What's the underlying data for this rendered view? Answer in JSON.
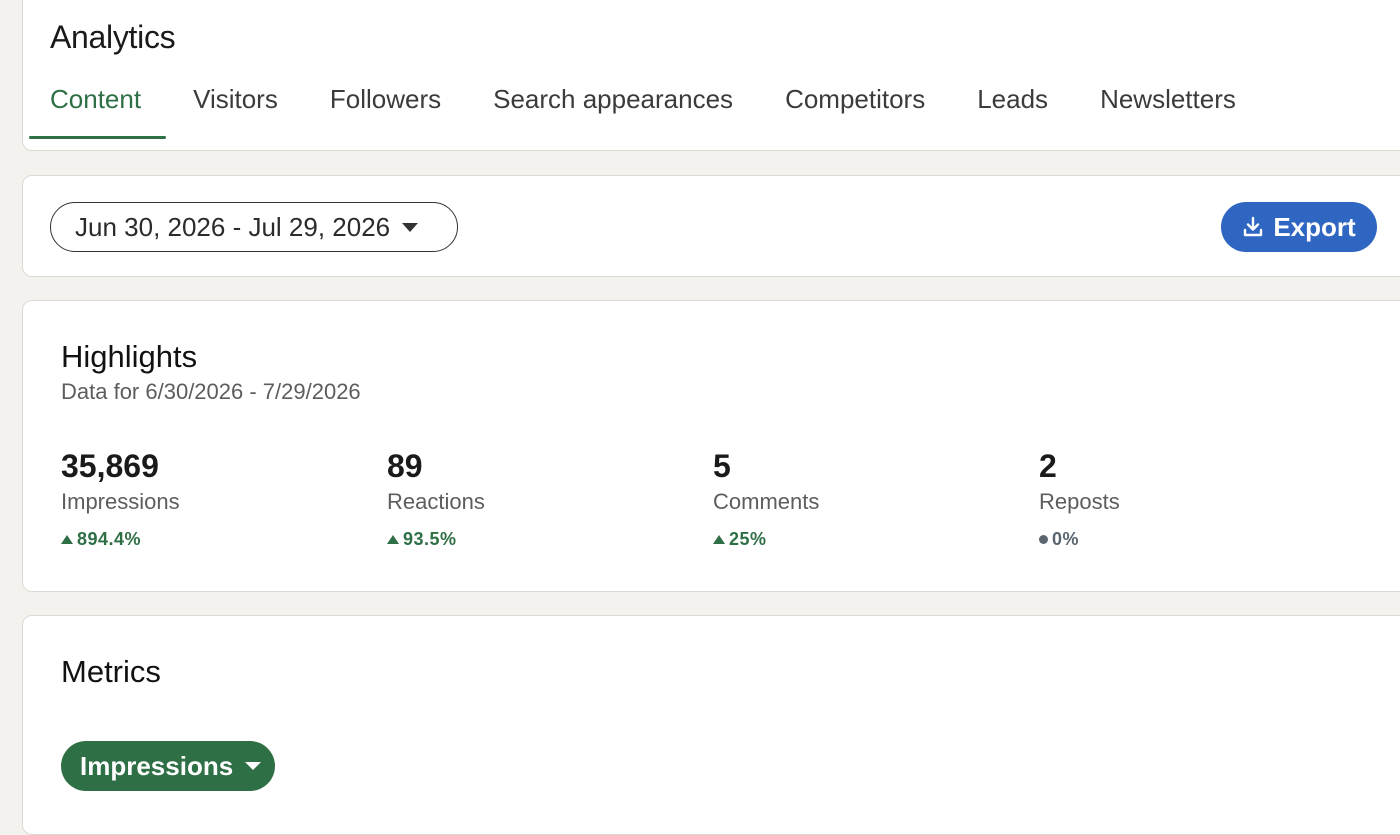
{
  "header": {
    "title": "Analytics",
    "tabs": [
      {
        "label": "Content",
        "active": true
      },
      {
        "label": "Visitors",
        "active": false
      },
      {
        "label": "Followers",
        "active": false
      },
      {
        "label": "Search appearances",
        "active": false
      },
      {
        "label": "Competitors",
        "active": false
      },
      {
        "label": "Leads",
        "active": false
      },
      {
        "label": "Newsletters",
        "active": false
      }
    ]
  },
  "toolbar": {
    "date_range": "Jun 30, 2026 - Jul 29, 2026",
    "export_label": "Export"
  },
  "highlights": {
    "title": "Highlights",
    "subtitle": "Data for 6/30/2026 - 7/29/2026",
    "stats": [
      {
        "value": "35,869",
        "label": "Impressions",
        "change": "894.4%",
        "trend": "up"
      },
      {
        "value": "89",
        "label": "Reactions",
        "change": "93.5%",
        "trend": "up"
      },
      {
        "value": "5",
        "label": "Comments",
        "change": "25%",
        "trend": "up"
      },
      {
        "value": "2",
        "label": "Reposts",
        "change": "0%",
        "trend": "flat"
      }
    ]
  },
  "metrics": {
    "title": "Metrics",
    "selected_metric": "Impressions"
  },
  "colors": {
    "accent_green": "#2f6f46",
    "button_blue": "#2f66c2",
    "page_background": "#f4f2ee"
  }
}
